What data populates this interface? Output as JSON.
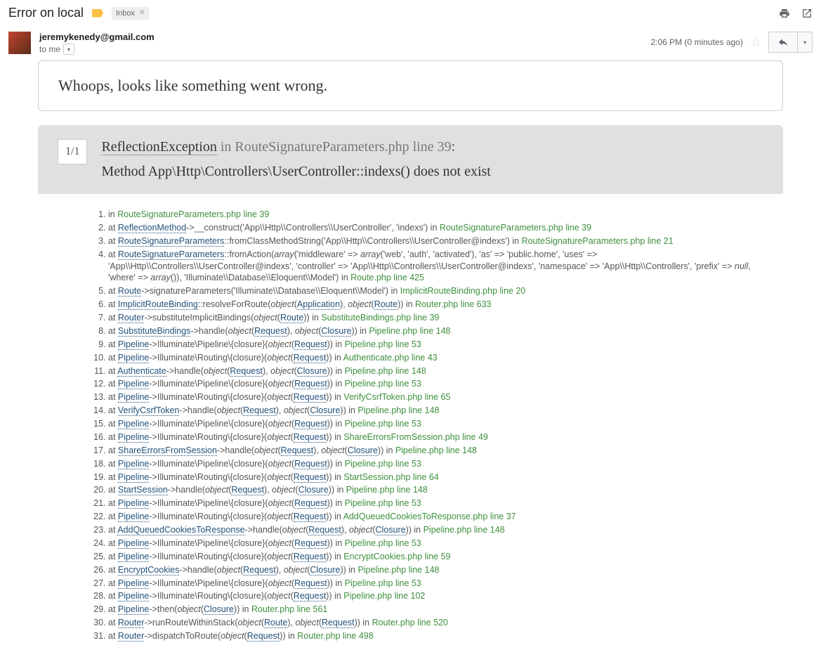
{
  "header": {
    "subject": "Error on local",
    "inbox_label": "Inbox"
  },
  "sender": {
    "email": "jeremykenedy@gmail.com",
    "to": "to me",
    "timestamp": "2:06 PM (0 minutes ago)"
  },
  "banner": {
    "text": "Whoops, looks like something went wrong."
  },
  "exception": {
    "counter": "1/1",
    "name": "ReflectionException",
    "in": " in ",
    "file": "RouteSignatureParameters.php line 39",
    "colon": ":",
    "message": "Method App\\Http\\Controllers\\UserController::indexs() does not exist"
  },
  "trace": [
    {
      "html": "in <span class='file'>RouteSignatureParameters.php line 39</span>"
    },
    {
      "html": "at <span class='cls'>ReflectionMethod</span>->__construct('App\\\\Http\\\\Controllers\\\\UserController', 'indexs') in <span class='file'>RouteSignatureParameters.php line 39</span>"
    },
    {
      "html": "at <span class='cls'>RouteSignatureParameters</span>::fromClassMethodString('App\\\\Http\\\\Controllers\\\\UserController@indexs') in <span class='file'>RouteSignatureParameters.php line 21</span>"
    },
    {
      "html": "at <span class='cls'>RouteSignatureParameters</span>::fromAction(<span class='ital'>array</span>('middleware' =&gt; <span class='ital'>array</span>('web', 'auth', 'activated'), 'as' =&gt; 'public.home', 'uses' =&gt; 'App\\\\Http\\\\Controllers\\\\UserController@indexs', 'controller' =&gt; 'App\\\\Http\\\\Controllers\\\\UserController@indexs', 'namespace' =&gt; 'App\\\\Http\\\\Controllers', 'prefix' =&gt; <span class='null'>null</span>, 'where' =&gt; <span class='ital'>array</span>()), 'Illuminate\\\\Database\\\\Eloquent\\\\Model') in <span class='file'>Route.php line 425</span>"
    },
    {
      "html": "at <span class='cls'>Route</span>->signatureParameters('Illuminate\\\\Database\\\\Eloquent\\\\Model') in <span class='file'>ImplicitRouteBinding.php line 20</span>"
    },
    {
      "html": "at <span class='cls'>ImplicitRouteBinding</span>::resolveForRoute(<span class='ital'>object</span>(<span class='cls'>Application</span>), <span class='ital'>object</span>(<span class='cls'>Route</span>)) in <span class='file'>Router.php line 633</span>"
    },
    {
      "html": "at <span class='cls'>Router</span>->substituteImplicitBindings(<span class='ital'>object</span>(<span class='cls'>Route</span>)) in <span class='file'>SubstituteBindings.php line 39</span>"
    },
    {
      "html": "at <span class='cls'>SubstituteBindings</span>->handle(<span class='ital'>object</span>(<span class='cls'>Request</span>), <span class='ital'>object</span>(<span class='cls'>Closure</span>)) in <span class='file'>Pipeline.php line 148</span>"
    },
    {
      "html": "at <span class='cls'>Pipeline</span>->Illuminate\\Pipeline\\{closure}(<span class='ital'>object</span>(<span class='cls'>Request</span>)) in <span class='file'>Pipeline.php line 53</span>"
    },
    {
      "html": "at <span class='cls'>Pipeline</span>->Illuminate\\Routing\\{closure}(<span class='ital'>object</span>(<span class='cls'>Request</span>)) in <span class='file'>Authenticate.php line 43</span>"
    },
    {
      "html": "at <span class='cls'>Authenticate</span>->handle(<span class='ital'>object</span>(<span class='cls'>Request</span>), <span class='ital'>object</span>(<span class='cls'>Closure</span>)) in <span class='file'>Pipeline.php line 148</span>"
    },
    {
      "html": "at <span class='cls'>Pipeline</span>->Illuminate\\Pipeline\\{closure}(<span class='ital'>object</span>(<span class='cls'>Request</span>)) in <span class='file'>Pipeline.php line 53</span>"
    },
    {
      "html": "at <span class='cls'>Pipeline</span>->Illuminate\\Routing\\{closure}(<span class='ital'>object</span>(<span class='cls'>Request</span>)) in <span class='file'>VerifyCsrfToken.php line 65</span>"
    },
    {
      "html": "at <span class='cls'>VerifyCsrfToken</span>->handle(<span class='ital'>object</span>(<span class='cls'>Request</span>), <span class='ital'>object</span>(<span class='cls'>Closure</span>)) in <span class='file'>Pipeline.php line 148</span>"
    },
    {
      "html": "at <span class='cls'>Pipeline</span>->Illuminate\\Pipeline\\{closure}(<span class='ital'>object</span>(<span class='cls'>Request</span>)) in <span class='file'>Pipeline.php line 53</span>"
    },
    {
      "html": "at <span class='cls'>Pipeline</span>->Illuminate\\Routing\\{closure}(<span class='ital'>object</span>(<span class='cls'>Request</span>)) in <span class='file'>ShareErrorsFromSession.php line 49</span>"
    },
    {
      "html": "at <span class='cls'>ShareErrorsFromSession</span>->handle(<span class='ital'>object</span>(<span class='cls'>Request</span>), <span class='ital'>object</span>(<span class='cls'>Closure</span>)) in <span class='file'>Pipeline.php line 148</span>"
    },
    {
      "html": "at <span class='cls'>Pipeline</span>->Illuminate\\Pipeline\\{closure}(<span class='ital'>object</span>(<span class='cls'>Request</span>)) in <span class='file'>Pipeline.php line 53</span>"
    },
    {
      "html": "at <span class='cls'>Pipeline</span>->Illuminate\\Routing\\{closure}(<span class='ital'>object</span>(<span class='cls'>Request</span>)) in <span class='file'>StartSession.php line 64</span>"
    },
    {
      "html": "at <span class='cls'>StartSession</span>->handle(<span class='ital'>object</span>(<span class='cls'>Request</span>), <span class='ital'>object</span>(<span class='cls'>Closure</span>)) in <span class='file'>Pipeline.php line 148</span>"
    },
    {
      "html": "at <span class='cls'>Pipeline</span>->Illuminate\\Pipeline\\{closure}(<span class='ital'>object</span>(<span class='cls'>Request</span>)) in <span class='file'>Pipeline.php line 53</span>"
    },
    {
      "html": "at <span class='cls'>Pipeline</span>->Illuminate\\Routing\\{closure}(<span class='ital'>object</span>(<span class='cls'>Request</span>)) in <span class='file'>AddQueuedCookiesToResponse.php line 37</span>"
    },
    {
      "html": "at <span class='cls'>AddQueuedCookiesToResponse</span>->handle(<span class='ital'>object</span>(<span class='cls'>Request</span>), <span class='ital'>object</span>(<span class='cls'>Closure</span>)) in <span class='file'>Pipeline.php line 148</span>"
    },
    {
      "html": "at <span class='cls'>Pipeline</span>->Illuminate\\Pipeline\\{closure}(<span class='ital'>object</span>(<span class='cls'>Request</span>)) in <span class='file'>Pipeline.php line 53</span>"
    },
    {
      "html": "at <span class='cls'>Pipeline</span>->Illuminate\\Routing\\{closure}(<span class='ital'>object</span>(<span class='cls'>Request</span>)) in <span class='file'>EncryptCookies.php line 59</span>"
    },
    {
      "html": "at <span class='cls'>EncryptCookies</span>->handle(<span class='ital'>object</span>(<span class='cls'>Request</span>), <span class='ital'>object</span>(<span class='cls'>Closure</span>)) in <span class='file'>Pipeline.php line 148</span>"
    },
    {
      "html": "at <span class='cls'>Pipeline</span>->Illuminate\\Pipeline\\{closure}(<span class='ital'>object</span>(<span class='cls'>Request</span>)) in <span class='file'>Pipeline.php line 53</span>"
    },
    {
      "html": "at <span class='cls'>Pipeline</span>->Illuminate\\Routing\\{closure}(<span class='ital'>object</span>(<span class='cls'>Request</span>)) in <span class='file'>Pipeline.php line 102</span>"
    },
    {
      "html": "at <span class='cls'>Pipeline</span>->then(<span class='ital'>object</span>(<span class='cls'>Closure</span>)) in <span class='file'>Router.php line 561</span>"
    },
    {
      "html": "at <span class='cls'>Router</span>->runRouteWithinStack(<span class='ital'>object</span>(<span class='cls'>Route</span>), <span class='ital'>object</span>(<span class='cls'>Request</span>)) in <span class='file'>Router.php line 520</span>"
    },
    {
      "html": "at <span class='cls'>Router</span>->dispatchToRoute(<span class='ital'>object</span>(<span class='cls'>Request</span>)) in <span class='file'>Router.php line 498</span>"
    }
  ]
}
